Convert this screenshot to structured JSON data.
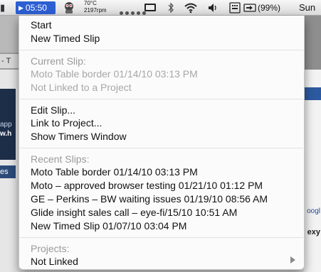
{
  "background": {
    "tab_text": "- T",
    "left_text": "app",
    "left_text2": "w.h",
    "left_bar": "es",
    "right_text1": "oogl",
    "right_text2": "exy"
  },
  "menubar": {
    "timer": "05:50",
    "temperature": "70°C",
    "rpm": "2197rpm",
    "battery": "(99%)",
    "clock": "Sun",
    "icons": [
      "robot-icon",
      "activity-dots-icon",
      "display-icon",
      "bluetooth-icon",
      "wifi-icon",
      "volume-icon",
      "keyboard-icon",
      "power-icon"
    ]
  },
  "menu": {
    "start": "Start",
    "new_timed_slip": "New Timed Slip",
    "current_header": "Current Slip:",
    "current_slip": "Moto Table border 01/14/10 03:13 PM",
    "current_project": "Not Linked to a Project",
    "edit_slip": "Edit Slip...",
    "link_project": "Link to Project...",
    "show_timers": "Show Timers Window",
    "recent_header": "Recent Slips:",
    "recent": [
      "Moto Table border 01/14/10 03:13 PM",
      "Moto – approved browser testing 01/21/10 01:12 PM",
      "GE – Perkins – BW waiting issues 01/19/10 08:56 AM",
      "Glide insight sales call – eye-fi/15/10 10:51 AM",
      "New Timed Slip 01/07/10 03:04 PM"
    ],
    "projects_header": "Projects:",
    "not_linked": "Not Linked"
  }
}
